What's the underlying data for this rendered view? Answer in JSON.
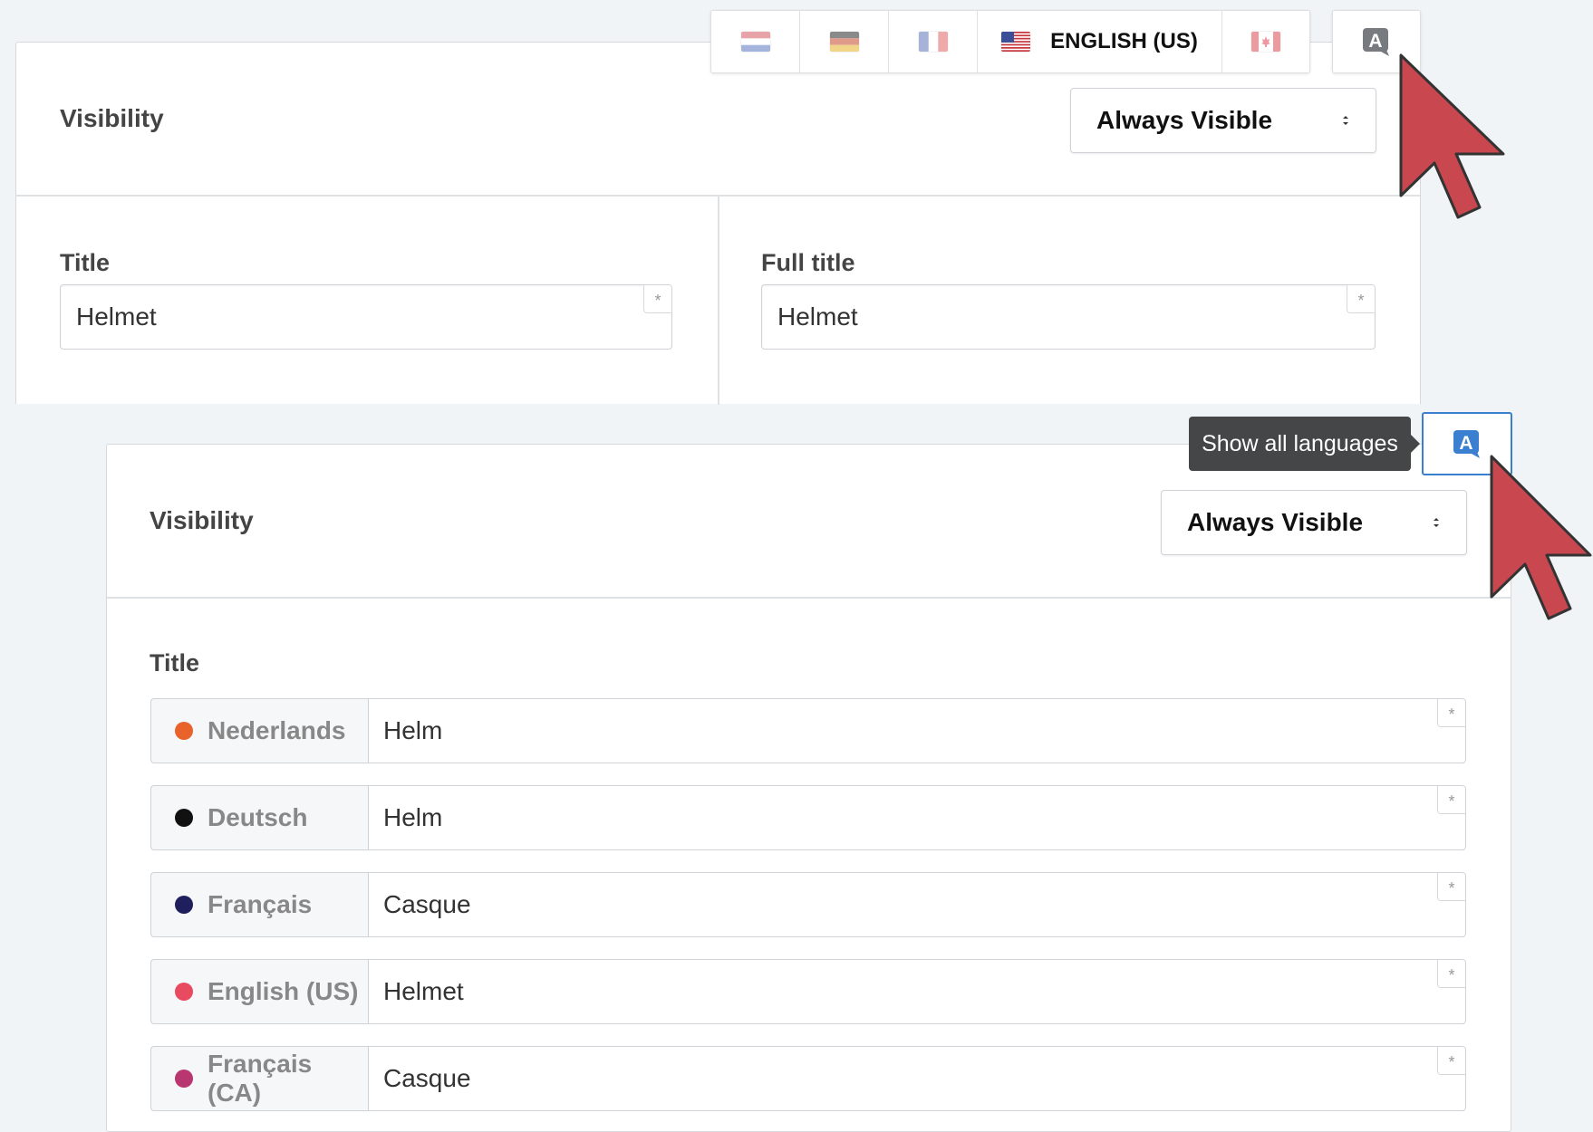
{
  "top_panel": {
    "visibility_label": "Visibility",
    "visibility_value": "Always Visible",
    "title_label": "Title",
    "title_value": "Helmet",
    "full_title_label": "Full title",
    "full_title_value": "Helmet",
    "required_marker": "*"
  },
  "language_bar": {
    "active_label": "ENGLISH (US)",
    "toggle_glyph": "A",
    "flags": [
      "flag-nl-icon",
      "flag-de-icon",
      "flag-fr-icon",
      "flag-us-icon",
      "flag-ca-icon"
    ]
  },
  "tooltip": {
    "text": "Show all languages"
  },
  "bottom_panel": {
    "visibility_label": "Visibility",
    "visibility_value": "Always Visible",
    "title_label": "Title",
    "toggle_glyph": "A",
    "languages": [
      {
        "name": "Nederlands",
        "value": "Helm",
        "color": "#e8622a"
      },
      {
        "name": "Deutsch",
        "value": "Helm",
        "color": "#111111"
      },
      {
        "name": "Français",
        "value": "Casque",
        "color": "#1e1f5c"
      },
      {
        "name": "English (US)",
        "value": "Helmet",
        "color": "#e84a5f"
      },
      {
        "name": "Français (CA)",
        "value": "Casque",
        "color": "#b83771"
      }
    ]
  },
  "colors": {
    "accent_blue": "#3b7fd0",
    "cursor_red": "#c9474f",
    "tooltip_bg": "#444647"
  }
}
